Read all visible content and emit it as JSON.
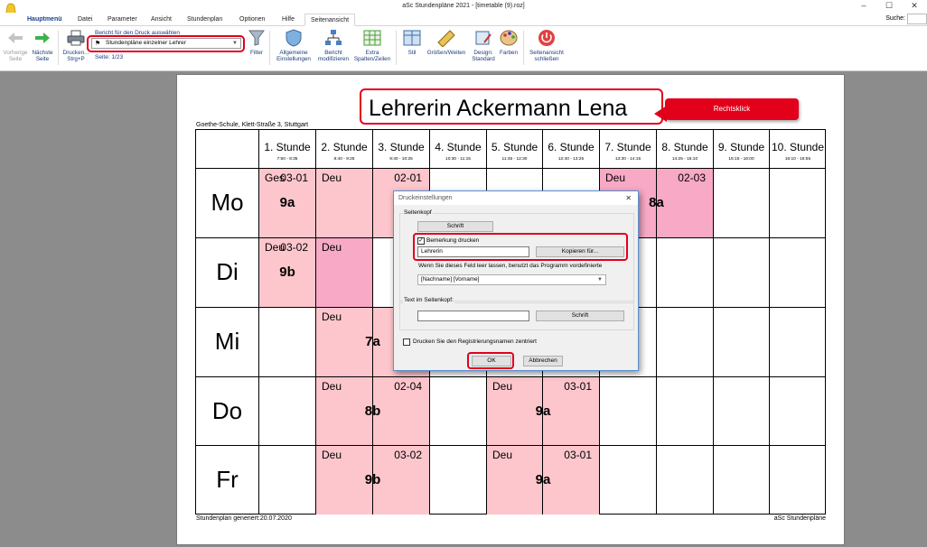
{
  "window": {
    "title": "aSc Stundenpläne 2021 - [timetable (9).roz]",
    "controls": [
      "–",
      "☐",
      "✕"
    ]
  },
  "menu": {
    "tabs": [
      "Hauptmenü",
      "Datei",
      "Parameter",
      "Ansicht",
      "Stundenplan",
      "Optionen",
      "Hilfe",
      "Seitenansicht"
    ],
    "active_tab": "Seitenansicht",
    "search_label": "Suche:"
  },
  "ribbon": {
    "prev_page": "Vorherige Seite",
    "next_page": "Nächste Seite",
    "print": "Drucken... Strg+P",
    "report_label": "Bericht für den Druck auswählen",
    "report_value": "Stundenpläne einzelner Lehrer",
    "page_info": "Seite: 1/23",
    "filter": "Filter",
    "general_settings": "Allgemeine Einstellungen",
    "modify_report": "Bericht modifizieren",
    "extra_columns": "Extra Spalten/Zeilen",
    "style": "Stil",
    "sizes": "Größen/Weiten",
    "design": "Design: Standard",
    "colors": "Farben",
    "close_preview": "Seitenansicht schließen"
  },
  "page": {
    "title": "Lehrerin Ackermann Lena",
    "callout": "Rechtsklick",
    "school": "Goethe-Schule, Klett-Straße 3, Stuttgart",
    "footer_left": "Stundenplan generiert:20.07.2020",
    "footer_right": "aSc Stundenpläne"
  },
  "timetable": {
    "periods": [
      {
        "name": "1. Stunde",
        "time": "7:50 - 8:35"
      },
      {
        "name": "2. Stunde",
        "time": "8:40 - 9:25"
      },
      {
        "name": "3. Stunde",
        "time": "9:40 - 10:25"
      },
      {
        "name": "4. Stunde",
        "time": "10:30 - 11:15"
      },
      {
        "name": "5. Stunde",
        "time": "11:45 - 12:30"
      },
      {
        "name": "6. Stunde",
        "time": "12:40 - 13:25"
      },
      {
        "name": "7. Stunde",
        "time": "13:30 - 14:15"
      },
      {
        "name": "8. Stunde",
        "time": "14:25 - 15:10"
      },
      {
        "name": "9. Stunde",
        "time": "15:15 - 16:00"
      },
      {
        "name": "10. Stunde",
        "time": "16:10 - 16:55"
      }
    ],
    "days": [
      "Mo",
      "Di",
      "Mi",
      "Do",
      "Fr"
    ],
    "lessons": [
      {
        "day": 0,
        "start": 1,
        "span": 1,
        "subject": "Ges",
        "room": "03-01",
        "class": "9a",
        "style": "light"
      },
      {
        "day": 0,
        "start": 2,
        "span": 2,
        "subject": "Deu",
        "room": "02-01",
        "class": "",
        "style": "light"
      },
      {
        "day": 0,
        "start": 7,
        "span": 2,
        "subject": "Deu",
        "room": "02-03",
        "class": "8a",
        "style": "pink"
      },
      {
        "day": 1,
        "start": 1,
        "span": 1,
        "subject": "Deu",
        "room": "03-02",
        "class": "9b",
        "style": "light"
      },
      {
        "day": 1,
        "start": 2,
        "span": 1,
        "subject": "Deu",
        "room": "",
        "class": "",
        "style": "pink"
      },
      {
        "day": 2,
        "start": 2,
        "span": 2,
        "subject": "Deu",
        "room": "",
        "class": "7a",
        "style": "light"
      },
      {
        "day": 3,
        "start": 2,
        "span": 2,
        "subject": "Deu",
        "room": "02-04",
        "class": "8b",
        "style": "light"
      },
      {
        "day": 3,
        "start": 5,
        "span": 2,
        "subject": "Deu",
        "room": "03-01",
        "class": "9a",
        "style": "light"
      },
      {
        "day": 4,
        "start": 2,
        "span": 2,
        "subject": "Deu",
        "room": "03-02",
        "class": "9b",
        "style": "light"
      },
      {
        "day": 4,
        "start": 5,
        "span": 2,
        "subject": "Deu",
        "room": "03-01",
        "class": "9a",
        "style": "light"
      }
    ]
  },
  "dialog": {
    "title": "Druckeinstellungen",
    "header_group": "Seitenkopf",
    "font_button": "Schrift",
    "remark_checkbox": "Bemerkung drucken",
    "remark_checked": true,
    "remark_value": "Lehrerin",
    "copy_button": "Kopieren für...",
    "hint": "Wenn Sie dieses Feld leer lassen, benutzt das Programm vordefinierte",
    "name_format": "[Nachname] [Vorname]",
    "header_text_group": "Text im Seitenkopf:",
    "header_text_value": "",
    "font_button_2": "Schrift",
    "center_reg_checkbox": "Drucken Sie den Registrierungsnamen zentriert",
    "center_reg_checked": false,
    "ok": "OK",
    "cancel": "Abbrechen"
  },
  "colors": {
    "highlight": "#e3001b",
    "lesson_light": "#fcc6cc",
    "lesson_pink": "#f7a9c6",
    "ribbon_text": "#1a3c78"
  }
}
